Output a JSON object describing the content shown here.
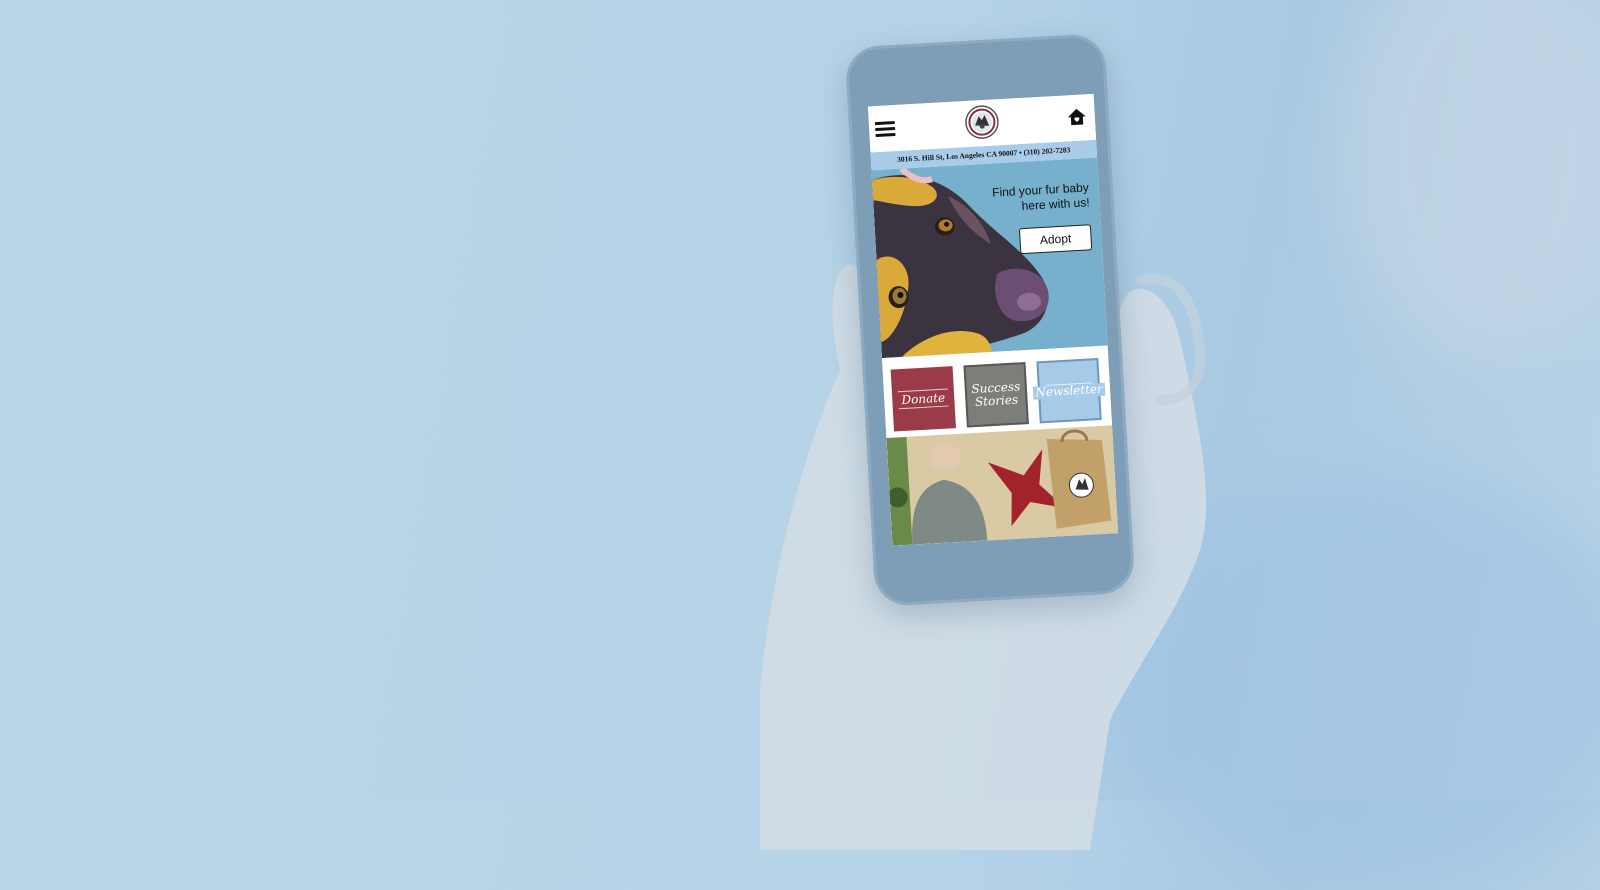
{
  "header": {
    "menu_icon": "hamburger-menu-icon",
    "logo_icon": "shelter-seal-logo",
    "home_icon": "house-heart-icon"
  },
  "address": {
    "text": "3016 S. Hill St, Los Angeles CA 90007 • (310) 202-7283"
  },
  "hero": {
    "tagline_line1": "Find your fur baby",
    "tagline_line2": "here with us!",
    "adopt_label": "Adopt"
  },
  "tiles": {
    "donate": "Donate",
    "success_line1": "Success",
    "success_line2": "Stories",
    "newsletter": "Newsletter"
  },
  "colors": {
    "donate": "#9b3b4a",
    "success": "#7b7e79",
    "newsletter": "#a5cbe8",
    "address_bar": "#a9cde9",
    "hero_bg": "#76b0cc"
  }
}
